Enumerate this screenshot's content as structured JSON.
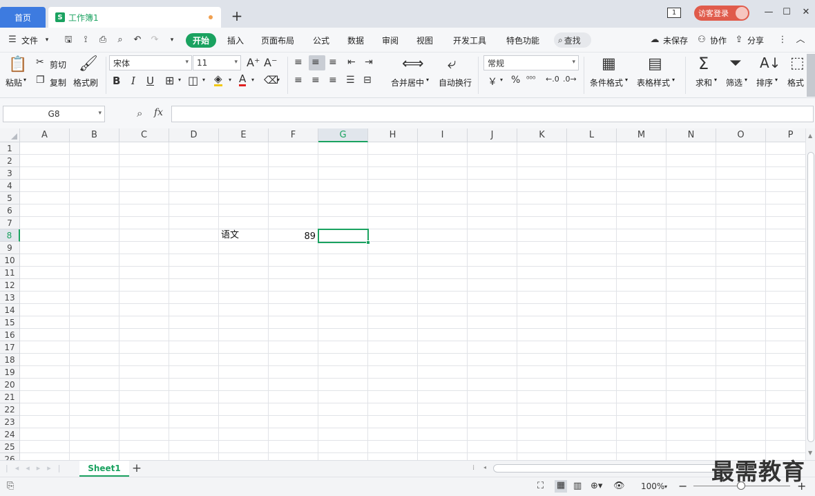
{
  "titlebar": {
    "home_tab": "首页",
    "book_tab": "工作簿1",
    "book_icon_letter": "S",
    "add_tab": "+",
    "window_badge": "1",
    "login_label": "访客登录"
  },
  "menu": {
    "file": "文件",
    "start": "开始",
    "insert": "插入",
    "page_layout": "页面布局",
    "formula": "公式",
    "data": "数据",
    "review": "审阅",
    "view": "视图",
    "developer": "开发工具",
    "special": "特色功能",
    "search": "查找",
    "unsaved": "未保存",
    "collaborate": "协作",
    "share": "分享"
  },
  "ribbon": {
    "paste": "粘贴",
    "cut": "剪切",
    "copy": "复制",
    "format_painter": "格式刷",
    "font_name": "宋体",
    "font_size": "11",
    "merge_center": "合并居中",
    "wrap_text": "自动换行",
    "number_format": "常规",
    "conditional_format": "条件格式",
    "table_style": "表格样式",
    "sum": "求和",
    "filter": "筛选",
    "sort": "排序",
    "format": "格式"
  },
  "formula_bar": {
    "name_box": "G8",
    "fx": "fx",
    "content": ""
  },
  "grid": {
    "columns": [
      "A",
      "B",
      "C",
      "D",
      "E",
      "F",
      "G",
      "H",
      "I",
      "J",
      "K",
      "L",
      "M",
      "N",
      "O",
      "P"
    ],
    "rows": [
      "1",
      "2",
      "3",
      "4",
      "5",
      "6",
      "7",
      "8",
      "9",
      "10",
      "11",
      "12",
      "13",
      "14",
      "15",
      "16",
      "17",
      "18",
      "19",
      "20",
      "21",
      "22",
      "23",
      "24",
      "25",
      "26"
    ],
    "active_column": "G",
    "active_row": "8",
    "cells": {
      "E8": "语文",
      "F8": "89"
    }
  },
  "sheets": {
    "tabs": [
      "Sheet1"
    ],
    "add": "+"
  },
  "status": {
    "zoom": "100%"
  },
  "watermark": "最需教育",
  "colors": {
    "accent_green": "#1aa260",
    "home_tab_blue": "#3d7be0",
    "login_red": "#e05b4b"
  }
}
